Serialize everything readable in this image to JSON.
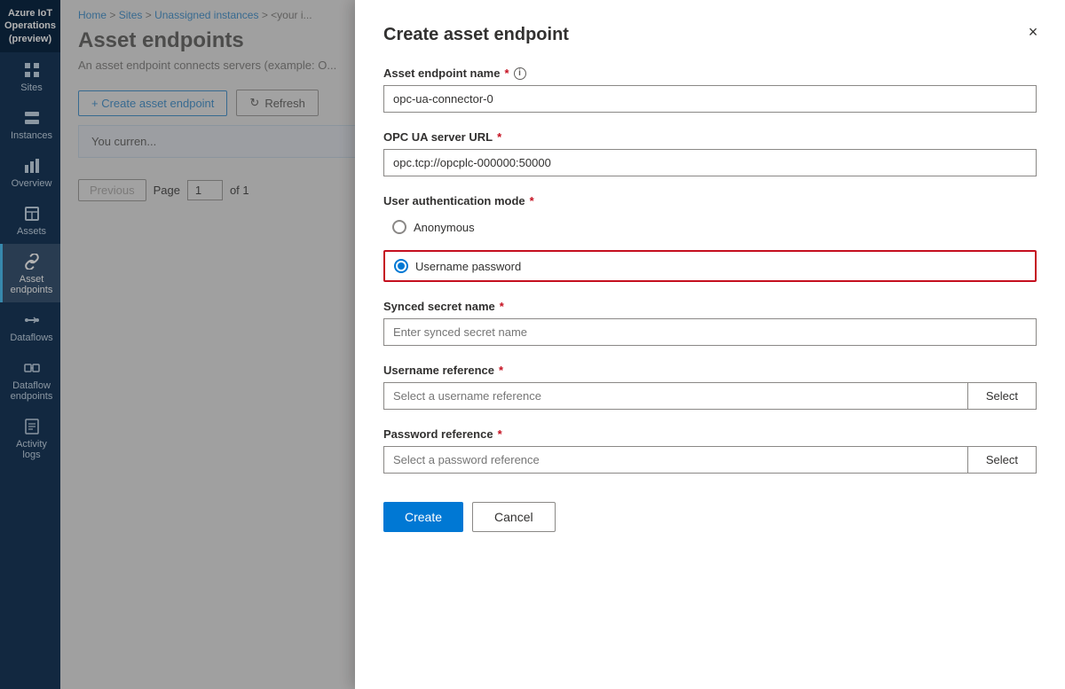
{
  "app": {
    "title": "Azure IoT Operations (preview)"
  },
  "sidebar": {
    "items": [
      {
        "id": "sites",
        "label": "Sites",
        "icon": "grid"
      },
      {
        "id": "instances",
        "label": "Instances",
        "icon": "server",
        "active": false
      },
      {
        "id": "overview",
        "label": "Overview",
        "icon": "chart"
      },
      {
        "id": "assets",
        "label": "Assets",
        "icon": "box"
      },
      {
        "id": "asset-endpoints",
        "label": "Asset endpoints",
        "icon": "link",
        "active": true
      },
      {
        "id": "dataflows",
        "label": "Dataflows",
        "icon": "flow"
      },
      {
        "id": "dataflow-endpoints",
        "label": "Dataflow endpoints",
        "icon": "endpoint"
      },
      {
        "id": "activity-logs",
        "label": "Activity logs",
        "icon": "log"
      }
    ]
  },
  "breadcrumb": {
    "parts": [
      "Home",
      "Sites",
      "Unassigned instances",
      "<your i..."
    ],
    "text": "Home > Sites > Unassigned instances > <your i..."
  },
  "page": {
    "title": "Asset endpoints",
    "description": "An asset endpoint connects servers (example: O..."
  },
  "toolbar": {
    "create_label": "+ Create asset endpoint",
    "refresh_label": "Refresh"
  },
  "notice": {
    "text": "You curren..."
  },
  "pagination": {
    "previous_label": "Previous",
    "page_label": "Page",
    "page_value": "1",
    "of_label": "of 1"
  },
  "modal": {
    "title": "Create asset endpoint",
    "close_label": "×",
    "fields": {
      "endpoint_name": {
        "label": "Asset endpoint name",
        "required": true,
        "has_info": true,
        "value": "opc-ua-connector-0",
        "placeholder": ""
      },
      "server_url": {
        "label": "OPC UA server URL",
        "required": true,
        "value": "opc.tcp://opcplc-000000:50000",
        "placeholder": ""
      },
      "auth_mode": {
        "label": "User authentication mode",
        "required": true,
        "options": [
          {
            "id": "anonymous",
            "label": "Anonymous",
            "selected": false
          },
          {
            "id": "username-password",
            "label": "Username password",
            "selected": true
          }
        ]
      },
      "synced_secret": {
        "label": "Synced secret name",
        "required": true,
        "value": "",
        "placeholder": "Enter synced secret name"
      },
      "username_ref": {
        "label": "Username reference",
        "required": true,
        "value": "",
        "placeholder": "Select a username reference",
        "select_label": "Select"
      },
      "password_ref": {
        "label": "Password reference",
        "required": true,
        "value": "",
        "placeholder": "Select a password reference",
        "select_label": "Select"
      }
    },
    "footer": {
      "create_label": "Create",
      "cancel_label": "Cancel"
    }
  }
}
